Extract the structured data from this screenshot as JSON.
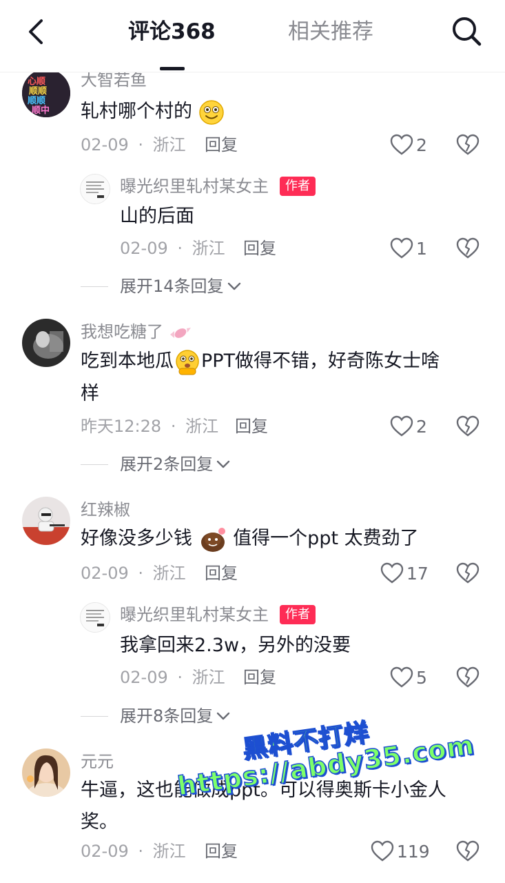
{
  "header": {
    "tab_comments": "评论368",
    "tab_related": "相关推荐"
  },
  "comments": [
    {
      "user": "大智若鱼",
      "text": "轧村哪个村的",
      "date": "02-09",
      "location": "浙江",
      "reply_label": "回复",
      "likes": "2",
      "avatar_text": [
        "心顺",
        "顺顺",
        "顺顺",
        "顺中"
      ],
      "replies": [
        {
          "user": "曝光织里轧村某女主",
          "badge": "作者",
          "text": "山的后面",
          "date": "02-09",
          "location": "浙江",
          "reply_label": "回复",
          "likes": "1"
        }
      ],
      "expand": "展开14条回复"
    },
    {
      "user": "我想吃糖了",
      "text_line1": "吃到本地瓜",
      "text_line1b": "PPT做得不错，好奇陈女士啥",
      "text_line2": "样",
      "date": "昨天12:28",
      "location": "浙江",
      "reply_label": "回复",
      "likes": "2",
      "expand": "展开2条回复"
    },
    {
      "user": "红辣椒",
      "text_a": "好像没多少钱",
      "text_b": "值得一个ppt 太费劲了",
      "date": "02-09",
      "location": "浙江",
      "reply_label": "回复",
      "likes": "17",
      "replies": [
        {
          "user": "曝光织里轧村某女主",
          "badge": "作者",
          "text": "我拿回来2.3w，另外的没要",
          "date": "02-09",
          "location": "浙江",
          "reply_label": "回复",
          "likes": "5"
        }
      ],
      "expand": "展开8条回复"
    },
    {
      "user": "元元",
      "text_line1": "牛逼，这也能做成ppt。可以得奥斯卡小金人",
      "text_line2": "奖。",
      "date": "02-09",
      "location": "浙江",
      "reply_label": "回复",
      "likes": "119"
    }
  ],
  "separator": "·",
  "watermark": {
    "line1": "黑料不打烊",
    "line2": "https://abdy35.com"
  },
  "colors": {
    "author_badge": "#fe2c55",
    "meta": "#a1a2a7",
    "watermark_fill": "#7dff6a",
    "watermark_stroke": "#1d4fd1"
  }
}
